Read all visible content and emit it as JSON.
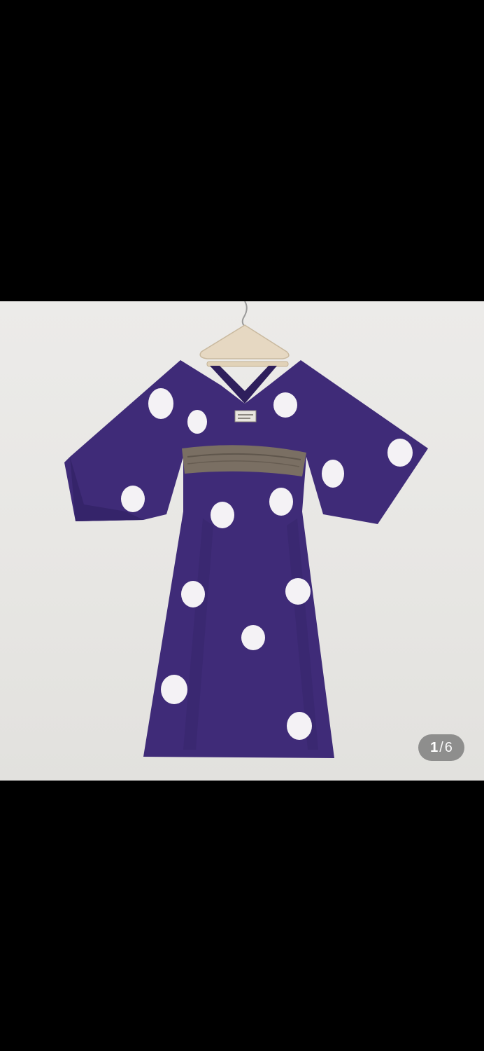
{
  "gallery": {
    "current_index": "1",
    "separator": "/",
    "total_count": "6"
  },
  "colors": {
    "background": "#000000",
    "wall": "#e9e8e5",
    "dress": "#3f2b78",
    "dots": "#f4f2f5",
    "belt": "#7a6f63",
    "counter_pill": "#6e6e6e"
  },
  "photo": {
    "subject_icon": "dress-photo-icon"
  }
}
